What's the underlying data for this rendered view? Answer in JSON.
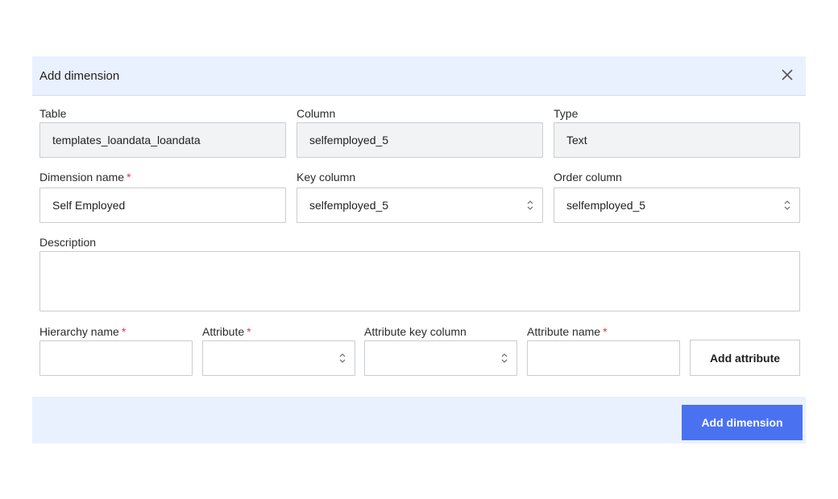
{
  "dialog": {
    "title": "Add dimension"
  },
  "fields": {
    "table": {
      "label": "Table",
      "value": "templates_loandata_loandata"
    },
    "column": {
      "label": "Column",
      "value": "selfemployed_5"
    },
    "type": {
      "label": "Type",
      "value": "Text"
    },
    "dimension_name": {
      "label": "Dimension name",
      "required_mark": "*",
      "value": "Self Employed"
    },
    "key_column": {
      "label": "Key column",
      "value": "selfemployed_5"
    },
    "order_column": {
      "label": "Order column",
      "value": "selfemployed_5"
    },
    "description": {
      "label": "Description",
      "value": ""
    },
    "hierarchy_name": {
      "label": "Hierarchy name",
      "required_mark": "*",
      "value": ""
    },
    "attribute": {
      "label": "Attribute",
      "required_mark": "*",
      "value": ""
    },
    "attribute_key_column": {
      "label": "Attribute key column",
      "value": ""
    },
    "attribute_name": {
      "label": "Attribute name",
      "required_mark": "*",
      "value": ""
    }
  },
  "buttons": {
    "add_attribute": "Add attribute",
    "add_dimension": "Add dimension"
  },
  "icons": {
    "close": "close-icon",
    "select": "chevron-up-down-icon"
  },
  "colors": {
    "header_bg": "#eaf1fe",
    "primary": "#4a72f0",
    "required": "#e53935",
    "readonly_bg": "#f2f3f5"
  }
}
